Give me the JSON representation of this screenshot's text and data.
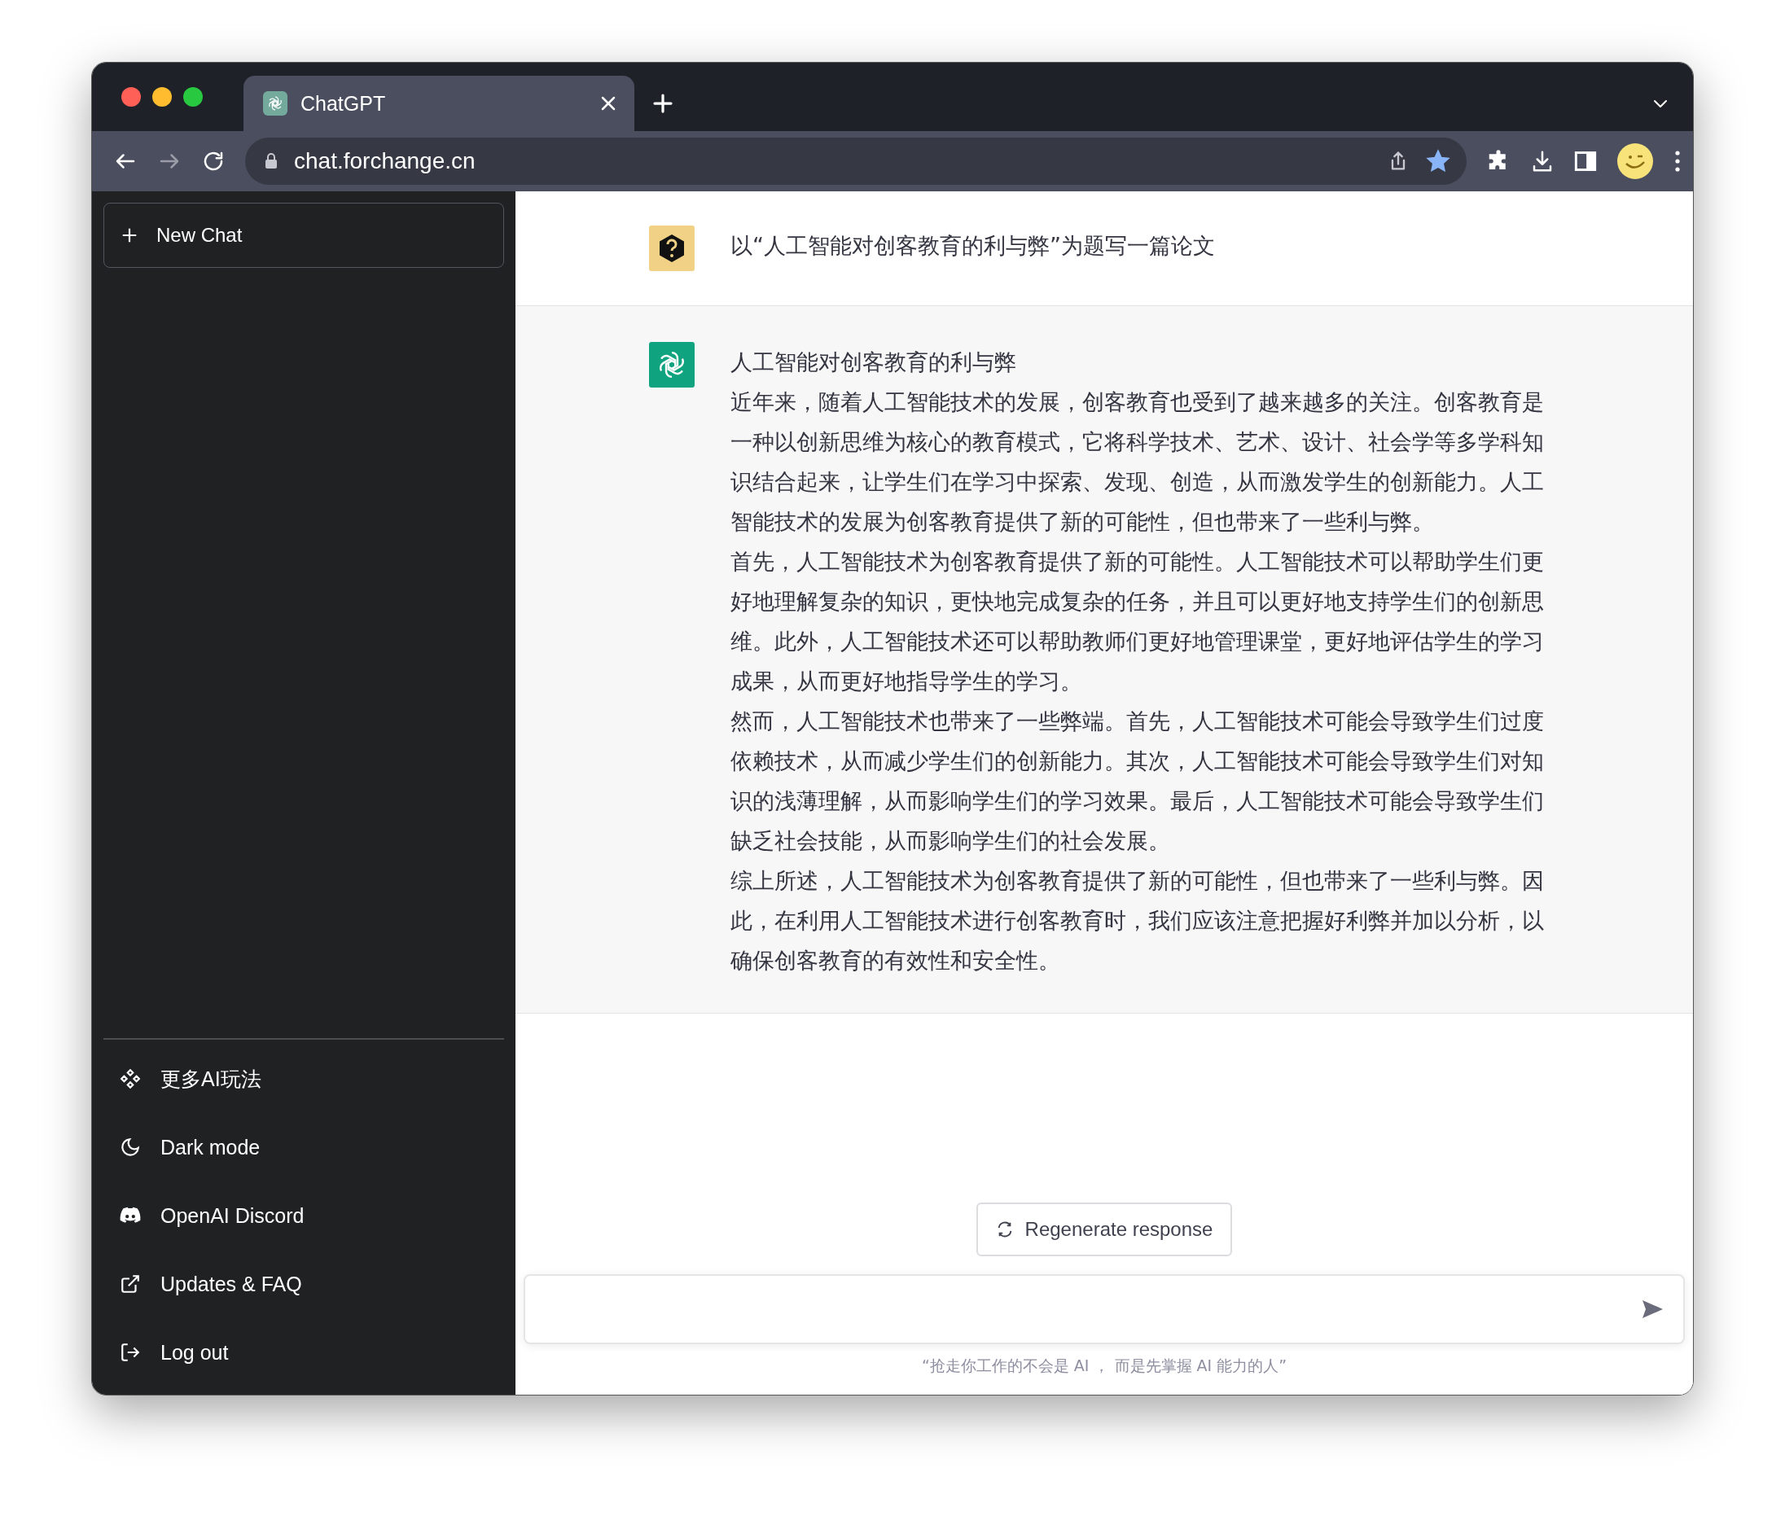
{
  "browser": {
    "tab": {
      "title": "ChatGPT",
      "selected": true
    },
    "url": "chat.forchange.cn",
    "bookmarked": true
  },
  "sidebar": {
    "new_chat": "New Chat",
    "items": [
      {
        "label": "更多AI玩法"
      },
      {
        "label": "Dark mode"
      },
      {
        "label": "OpenAI Discord"
      },
      {
        "label": "Updates & FAQ"
      },
      {
        "label": "Log out"
      }
    ]
  },
  "conversation": [
    {
      "kind": "prompt",
      "paragraphs": [
        "以“人工智能对创客教育的利与弊”为题写一篇论文"
      ]
    },
    {
      "kind": "answer",
      "paragraphs": [
        "人工智能对创客教育的利与弊",
        "近年来，随着人工智能技术的发展，创客教育也受到了越来越多的关注。创客教育是一种以创新思维为核心的教育模式，它将科学技术、艺术、设计、社会学等多学科知识结合起来，让学生们在学习中探索、发现、创造，从而激发学生的创新能力。人工智能技术的发展为创客教育提供了新的可能性，但也带来了一些利与弊。",
        "首先，人工智能技术为创客教育提供了新的可能性。人工智能技术可以帮助学生们更好地理解复杂的知识，更快地完成复杂的任务，并且可以更好地支持学生们的创新思维。此外，人工智能技术还可以帮助教师们更好地管理课堂，更好地评估学生的学习成果，从而更好地指导学生的学习。",
        "然而，人工智能技术也带来了一些弊端。首先，人工智能技术可能会导致学生们过度依赖技术，从而减少学生们的创新能力。其次，人工智能技术可能会导致学生们对知识的浅薄理解，从而影响学生们的学习效果。最后，人工智能技术可能会导致学生们缺乏社会技能，从而影响学生们的社会发展。",
        "综上所述，人工智能技术为创客教育提供了新的可能性，但也带来了一些利与弊。因此，在利用人工智能技术进行创客教育时，我们应该注意把握好利弊并加以分析，以确保创客教育的有效性和安全性。"
      ]
    }
  ],
  "regenerate": "Regenerate response",
  "footer": "“抢走你工作的不会是 AI ， 而是先掌握 AI 能力的人”"
}
